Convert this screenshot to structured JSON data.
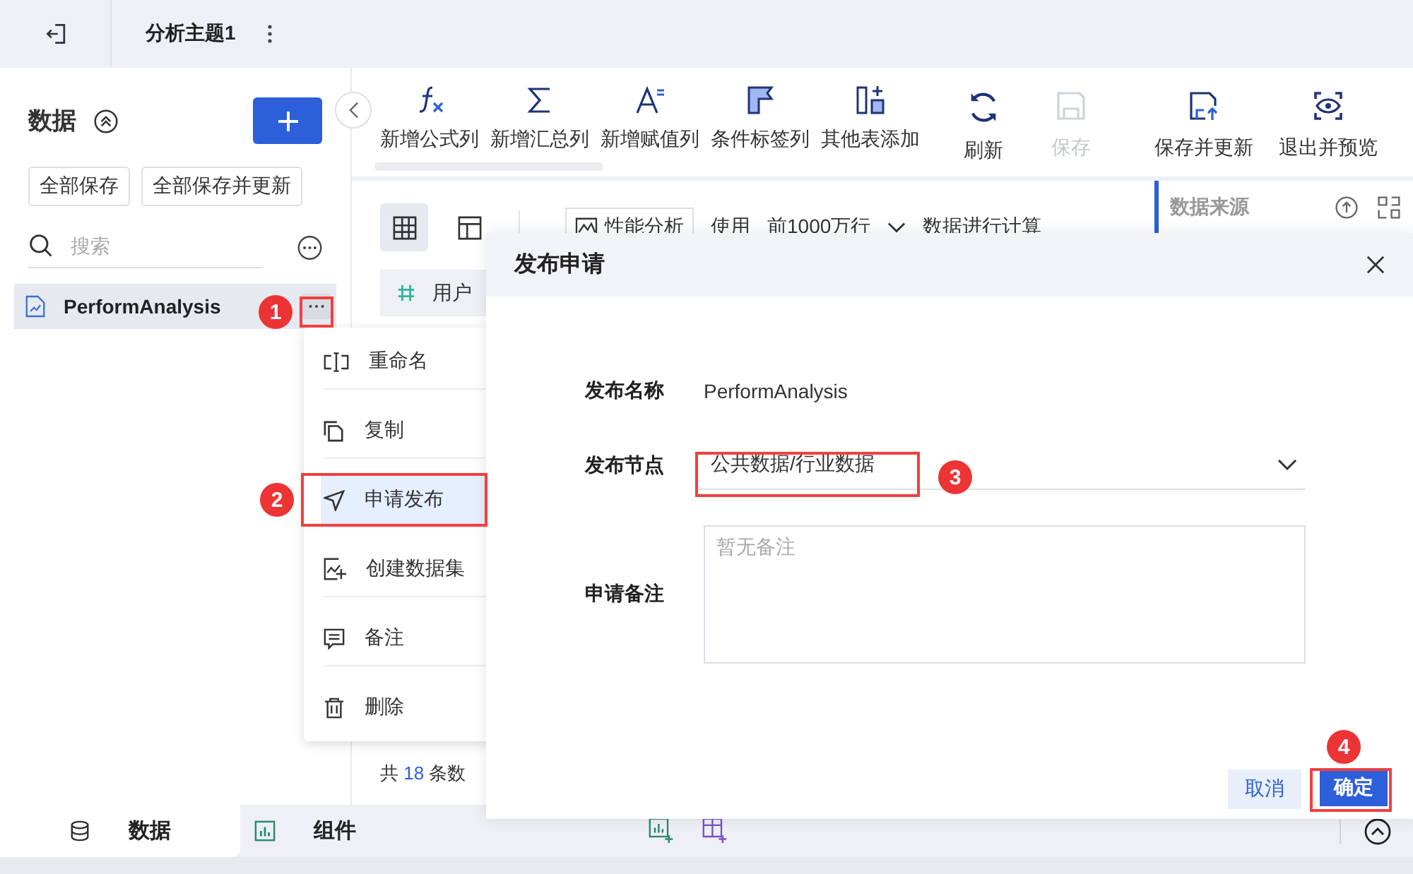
{
  "topbar": {
    "title": "分析主题1"
  },
  "sidebar": {
    "title": "数据",
    "buttons": [
      "全部保存",
      "全部保存并更新"
    ],
    "search": {
      "placeholder": "搜索"
    },
    "items": [
      {
        "label": "PerformAnalysis",
        "selected": true
      }
    ]
  },
  "toolbar": {
    "scroll_items": [
      {
        "label": "新增公式列"
      },
      {
        "label": "新增汇总列"
      },
      {
        "label": "新增赋值列"
      },
      {
        "label": "条件标签列"
      },
      {
        "label": "其他表添加"
      }
    ],
    "actions": [
      {
        "label": "刷新",
        "disabled": false
      },
      {
        "label": "保存",
        "disabled": true
      },
      {
        "label": "保存并更新",
        "disabled": false
      },
      {
        "label": "退出并预览",
        "disabled": false
      }
    ]
  },
  "view_toggles": [
    {
      "selected": true
    },
    {
      "selected": false
    }
  ],
  "options_bar": {
    "perf_button": "性能分析",
    "texts": [
      "使用",
      "前1000万行"
    ],
    "tail": "数据进行计算"
  },
  "side_panel": {
    "title": "数据来源"
  },
  "table": {
    "column": "用户",
    "footer": {
      "prefix": "共",
      "count": "18",
      "suffix": "条数"
    }
  },
  "bottom_tabs": [
    {
      "label": "数据",
      "selected": true
    },
    {
      "label": "组件",
      "selected": false
    }
  ],
  "context_menu": [
    {
      "label": "重命名",
      "selected": false
    },
    {
      "label": "复制",
      "selected": false
    },
    {
      "label": "申请发布",
      "selected": true
    },
    {
      "label": "创建数据集",
      "selected": false
    },
    {
      "label": "备注",
      "selected": false
    },
    {
      "label": "删除",
      "selected": false
    }
  ],
  "dialog": {
    "title": "发布申请",
    "fields": [
      {
        "kind": "text",
        "label": "发布名称",
        "value": "PerformAnalysis"
      },
      {
        "kind": "select",
        "label": "发布节点",
        "value": "公共数据/行业数据"
      },
      {
        "kind": "textarea",
        "label": "申请备注",
        "placeholder": "暂无备注"
      }
    ],
    "cancel": "取消",
    "confirm": "确定"
  },
  "callouts": [
    "1",
    "2",
    "3",
    "4"
  ]
}
